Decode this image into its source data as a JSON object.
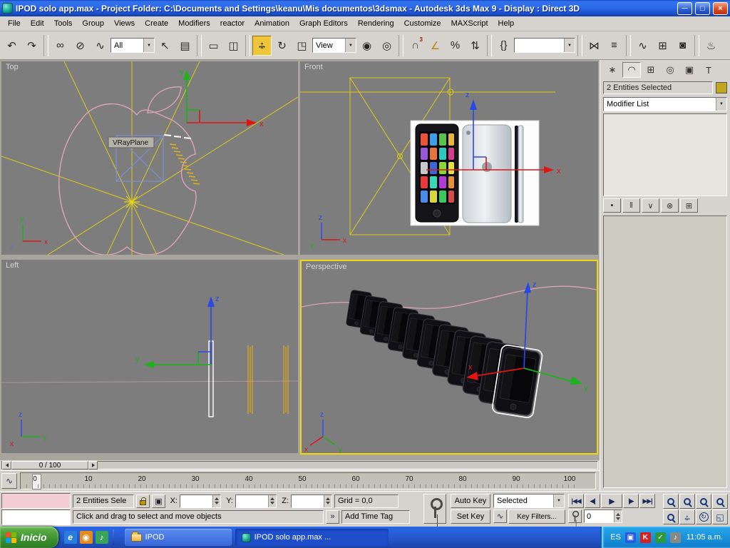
{
  "axis": {
    "x": "x",
    "y": "y",
    "z": "z"
  },
  "title_bar": {
    "title": "IPOD solo app.max    - Project Folder: C:\\Documents and Settings\\keanu\\Mis documentos\\3dsmax    - Autodesk 3ds Max 9   - Display : Direct 3D"
  },
  "menu_bar": {
    "items": [
      "File",
      "Edit",
      "Tools",
      "Group",
      "Views",
      "Create",
      "Modifiers",
      "reactor",
      "Animation",
      "Graph Editors",
      "Rendering",
      "Customize",
      "MAXScript",
      "Help"
    ]
  },
  "toolbar": {
    "selection_filter": "All",
    "reference_coordsys": "View",
    "named_selection": ""
  },
  "icons": {
    "undo": "↶",
    "redo": "↷",
    "link": "∞",
    "unlink": "⊘",
    "bind_space_warp": "∿",
    "select": "↖",
    "select_by_name": "▤",
    "rect_region": "▭",
    "window_crossing": "◫",
    "move_h": "↔",
    "move_v": "↕",
    "rotate": "↻",
    "scale": "◳",
    "pivot_center": "◉",
    "manipulate": "◎",
    "snap_magnet": "∩",
    "snap_3": "3",
    "angle_snap": "∠",
    "percent_snap": "%",
    "spinner_snap": "⇅",
    "named_sets": "{}",
    "mirror": "⋈",
    "align": "≡",
    "curve_editor": "∿",
    "schematic_view": "⊞",
    "material_editor": "◙",
    "render_scene": "♨",
    "dropdown_arrow": "▼",
    "tab_create": "∗",
    "tab_modify": "◠",
    "tab_hierarchy": "⊞",
    "tab_motion": "◎",
    "tab_display": "▣",
    "tab_utilities": "T",
    "pin_stack": "▪",
    "show_end_result": "‖",
    "make_unique": "∨",
    "remove_modifier": "⊗",
    "configure_modifier": "⊞",
    "go_start": "|◀◀",
    "prev_key": "◀|",
    "play": "▶",
    "next_key": "|▶",
    "go_end": "▶▶|",
    "min_curve_editor": "∿",
    "prompt_pen": "»",
    "abs_offset": "▣",
    "minmax_toggle": "◱",
    "arc_rotate": "↻",
    "window_min": "─",
    "window_max": "□",
    "window_close": "×",
    "quick_ie": "e",
    "quick_msn": "◉",
    "quick_media": "♪",
    "tray_monitor": "▣",
    "tray_k": "K",
    "tray_shield": "✓",
    "tray_volume": "♪"
  },
  "viewports": {
    "top": {
      "label": "Top",
      "object_label": "VRayPlane"
    },
    "front": {
      "label": "Front"
    },
    "left": {
      "label": "Left"
    },
    "perspective": {
      "label": "Perspective"
    }
  },
  "command_panel": {
    "selection_status": "2 Entities Selected",
    "modifier_list": "Modifier List"
  },
  "timeline": {
    "frame_display": "0 / 100",
    "ticks": [
      "0",
      "10",
      "20",
      "30",
      "40",
      "50",
      "60",
      "70",
      "80",
      "90",
      "100"
    ]
  },
  "status_bar": {
    "selection_count": "2 Entities Sele",
    "x_label": "X:",
    "y_label": "Y:",
    "z_label": "Z:",
    "x_value": "",
    "y_value": "",
    "z_value": "",
    "grid": "Grid = 0,0",
    "prompt": "Click and drag to select and move objects",
    "add_time_tag": "Add Time Tag",
    "auto_key": "Auto Key",
    "set_key": "Set Key",
    "key_mode_dropdown": "Selected",
    "key_filters": "Key Filters...",
    "frame_number": "0"
  },
  "taskbar": {
    "start": "Inicio",
    "tasks": [
      {
        "label": "IPOD"
      },
      {
        "label": "IPOD solo app.max    ..."
      }
    ],
    "tray": {
      "language": "ES",
      "time": "11:05 a.m."
    }
  }
}
